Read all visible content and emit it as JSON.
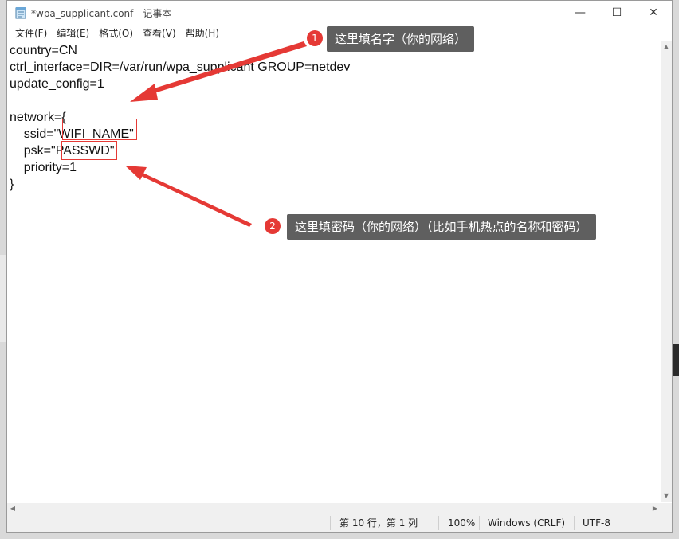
{
  "window": {
    "title": "*wpa_supplicant.conf - 记事本",
    "controls": {
      "minimize": "—",
      "maximize": "☐",
      "close": "✕"
    }
  },
  "menu": [
    "文件(F)",
    "编辑(E)",
    "格式(O)",
    "查看(V)",
    "帮助(H)"
  ],
  "editor": {
    "lines": [
      "country=CN",
      "ctrl_interface=DIR=/var/run/wpa_supplicant GROUP=netdev",
      "update_config=1",
      "",
      "network={",
      "    ssid=\"WIFI_NAME\"",
      "    psk=\"PASSWD\"",
      "    priority=1",
      "}"
    ]
  },
  "annotations": [
    {
      "badge": "1",
      "text": "这里填名字（你的网络）"
    },
    {
      "badge": "2",
      "text": "这里填密码（你的网络）（比如手机热点的名称和密码）"
    }
  ],
  "status": {
    "position": "第 10 行，第 1 列",
    "zoom": "100%",
    "line_ending": "Windows (CRLF)",
    "encoding": "UTF-8"
  },
  "colors": {
    "annotation_red": "#e53935",
    "callout_bg": "#5f5f5f"
  }
}
